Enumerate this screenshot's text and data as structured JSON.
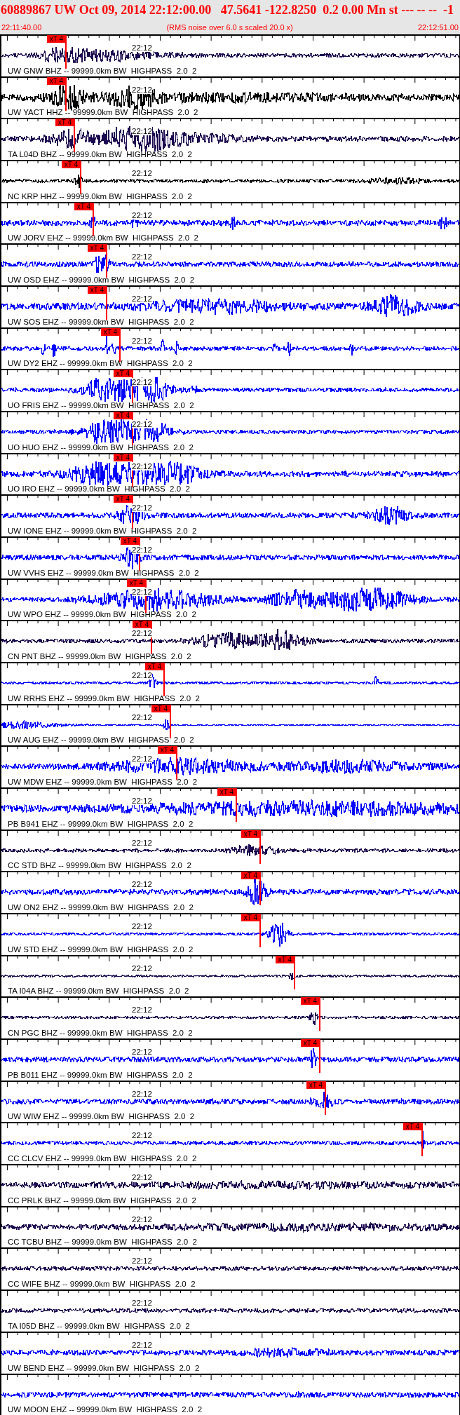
{
  "header": {
    "title": "60889867 UW Oct 09, 2014 22:12:00.00   47.5641 -122.8250  0.2 0.00 Mn st --- -- --  -1",
    "start_time": "22:11:40.00",
    "note": "(RMS noise over 6.0 s scaled 20.0 x)",
    "end_time": "22:12:51.00"
  },
  "traces": [
    {
      "station": "UW GNW BHZ -- 99999.0km BW  HIGHPASS  2.0  2",
      "time_mark": "22:12",
      "pick": "xT 4",
      "color": "#1c0a50"
    },
    {
      "station": "UW YACT HHZ -- 99999.0km BW  HIGHPASS  2.0  2",
      "time_mark": "22:12",
      "pick": "xT 4",
      "color": "#000000"
    },
    {
      "station": "TA L04D BHZ -- 99999.0km BW  HIGHPASS  2.0  2",
      "time_mark": "22:12",
      "pick": "xT 4",
      "color": "#1c0a50"
    },
    {
      "station": "NC KRP HHZ -- 99999.0km BW  HIGHPASS  2.0  2",
      "time_mark": "22:12",
      "pick": "xT 4",
      "color": "#000000"
    },
    {
      "station": "UW JORV EHZ -- 99999.0km BW  HIGHPASS  2.0  2",
      "time_mark": "22:12",
      "pick": "xT 4",
      "color": "#0000ff"
    },
    {
      "station": "UW OSD EHZ -- 99999.0km BW  HIGHPASS  2.0  2",
      "time_mark": "22:12",
      "pick": "xT 4",
      "color": "#0000ff"
    },
    {
      "station": "UW SOS EHZ -- 99999.0km BW  HIGHPASS  2.0  2",
      "time_mark": "22:12",
      "pick": "xT 4",
      "color": "#0000ff"
    },
    {
      "station": "UW DY2 EHZ -- 99999.0km BW  HIGHPASS  2.0  2",
      "time_mark": "22:12",
      "pick": "xT 4",
      "color": "#0000ff"
    },
    {
      "station": "UO FRIS EHZ -- 99999.0km BW  HIGHPASS  2.0  2",
      "time_mark": "22:12",
      "pick": "xT 4",
      "color": "#0000ff"
    },
    {
      "station": "UO HUO EHZ -- 99999.0km BW  HIGHPASS  2.0  2",
      "time_mark": "22:12",
      "pick": "xT 4",
      "color": "#0000ff"
    },
    {
      "station": "UO IRO EHZ -- 99999.0km BW  HIGHPASS  2.0  2",
      "time_mark": "22:12",
      "pick": "xT 4",
      "color": "#0000ff"
    },
    {
      "station": "UW IONE EHZ -- 99999.0km BW  HIGHPASS  2.0  2",
      "time_mark": "22:12",
      "pick": "xT 4",
      "color": "#0000ff"
    },
    {
      "station": "UW VVHS EHZ -- 99999.0km BW  HIGHPASS  2.0  2",
      "time_mark": "22:12",
      "pick": "xT 4",
      "color": "#0000ff"
    },
    {
      "station": "UW WPO EHZ -- 99999.0km BW  HIGHPASS  2.0  2",
      "time_mark": "22:12",
      "pick": "xT 4",
      "color": "#0000ff"
    },
    {
      "station": "CN PNT BHZ -- 99999.0km BW  HIGHPASS  2.0  2",
      "time_mark": "22:12",
      "pick": "xT 4",
      "color": "#1c0a50"
    },
    {
      "station": "UW RRHS EHZ -- 99999.0km BW  HIGHPASS  2.0  2",
      "time_mark": "22:12",
      "pick": "xT 4",
      "color": "#0000ff"
    },
    {
      "station": "UW AUG EHZ -- 99999.0km BW  HIGHPASS  2.0  2",
      "time_mark": "22:12",
      "pick": "xT 4",
      "color": "#0000ff"
    },
    {
      "station": "UW MDW EHZ -- 99999.0km BW  HIGHPASS  2.0  2",
      "time_mark": "22:12",
      "pick": "xT 4",
      "color": "#0000ff"
    },
    {
      "station": "PB B941 EHZ -- 99999.0km BW  HIGHPASS  2.0  2",
      "time_mark": "22:12",
      "pick": "xT 4",
      "color": "#0000ff"
    },
    {
      "station": "CC STD BHZ -- 99999.0km BW  HIGHPASS  2.0  2",
      "time_mark": "22:12",
      "pick": "xT 4",
      "color": "#1c0a50"
    },
    {
      "station": "UW ON2 EHZ -- 99999.0km BW  HIGHPASS  2.0  2",
      "time_mark": "22:12",
      "pick": "xT 4",
      "color": "#0000ff"
    },
    {
      "station": "UW STD EHZ -- 99999.0km BW  HIGHPASS  2.0  2",
      "time_mark": "22:12",
      "pick": "xT 4",
      "color": "#0000ff"
    },
    {
      "station": "TA I04A BHZ -- 99999.0km BW  HIGHPASS  2.0  2",
      "time_mark": "22:12",
      "pick": "xT 4",
      "color": "#1c0a50"
    },
    {
      "station": "CN PGC BHZ -- 99999.0km BW  HIGHPASS  2.0  2",
      "time_mark": "22:12",
      "pick": "xT 4",
      "color": "#1c0a50"
    },
    {
      "station": "PB B011 EHZ -- 99999.0km BW  HIGHPASS  2.0  2",
      "time_mark": "22:12",
      "pick": "xT 4",
      "color": "#0000ff"
    },
    {
      "station": "UW WIW EHZ -- 99999.0km BW  HIGHPASS  2.0  2",
      "time_mark": "22:12",
      "pick": "xT 4",
      "color": "#0000ff"
    },
    {
      "station": "CC CLCV EHZ -- 99999.0km BW  HIGHPASS  2.0  2",
      "time_mark": "22:12",
      "pick": "xT 4",
      "color": "#0000ff"
    },
    {
      "station": "CC PRLK BHZ -- 99999.0km BW  HIGHPASS  2.0  2",
      "time_mark": "22:12",
      "color": "#1c0a50"
    },
    {
      "station": "CC TCBU BHZ -- 99999.0km BW  HIGHPASS  2.0  2",
      "time_mark": "22:12",
      "color": "#1c0a50"
    },
    {
      "station": "CC WIFE BHZ -- 99999.0km BW  HIGHPASS  2.0  2",
      "time_mark": "22:12",
      "color": "#1c0a50"
    },
    {
      "station": "TA I05D BHZ -- 99999.0km BW  HIGHPASS  2.0  2",
      "time_mark": "22:12",
      "color": "#1c0a50"
    },
    {
      "station": "UW BEND EHZ -- 99999.0km BW  HIGHPASS  2.0  2",
      "time_mark": "22:12",
      "color": "#0000ff"
    },
    {
      "station": "UW MOON EHZ -- 99999.0km BW  HIGHPASS  2.0  2",
      "color": "#0000ff"
    }
  ]
}
